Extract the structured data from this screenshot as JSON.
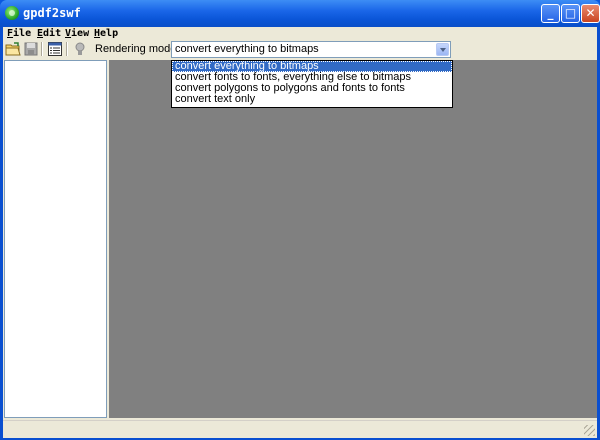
{
  "window": {
    "title": "gpdf2swf",
    "controls": {
      "minimize": "_",
      "maximize": "□",
      "close": "✕"
    }
  },
  "menu": [
    {
      "key": "F",
      "rest": "ile"
    },
    {
      "key": "E",
      "rest": "dit"
    },
    {
      "key": "V",
      "rest": "iew"
    },
    {
      "key": "H",
      "rest": "elp"
    }
  ],
  "toolbar": {
    "icons": [
      "open-folder-icon",
      "save-disk-icon",
      "properties-list-icon",
      "lightbulb-icon"
    ],
    "rendering_label": "Rendering mode:",
    "rendering_value": "convert everything to bitmaps"
  },
  "dropdown": {
    "options": [
      "convert everything to bitmaps",
      "convert fonts to fonts, everything else to bitmaps",
      "convert polygons to polygons and fonts to fonts",
      "convert text only"
    ],
    "selected_index": 0
  },
  "colors": {
    "title_bar": "#0a58e0",
    "viewer_bg": "#808080",
    "selection": "#316ac5",
    "window_face": "#ece9d8"
  }
}
